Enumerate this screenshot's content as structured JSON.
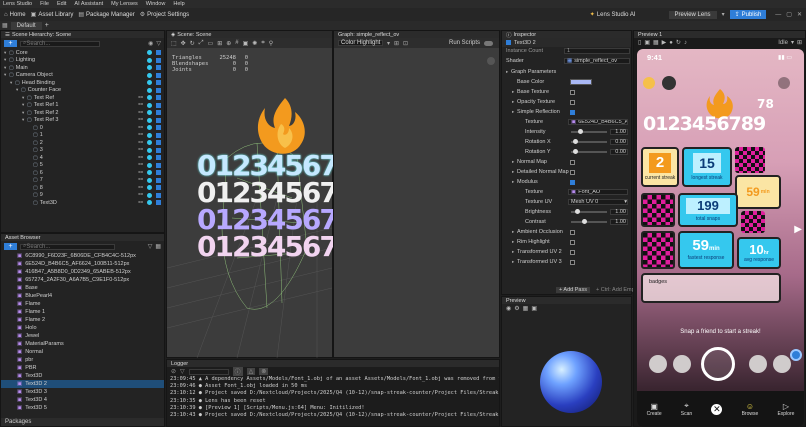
{
  "menu": {
    "items": [
      "Lens Studio",
      "File",
      "Edit",
      "AI Assistant",
      "My Lenses",
      "Window",
      "Help"
    ]
  },
  "toolbar": {
    "home": "Home",
    "asset_library": "Asset Library",
    "package_manager": "Package Manager",
    "project_settings": "Project Settings",
    "lens_studio_ai": "Lens Studio AI",
    "preview_lens": "Preview Lens",
    "publish": "Publish"
  },
  "tabs": {
    "default": "Default"
  },
  "hierarchy": {
    "title": "Scene Hierarchy: Scene",
    "search_placeholder": "Search...",
    "items": [
      {
        "label": "Core",
        "indent": 0
      },
      {
        "label": "Lighting",
        "indent": 0
      },
      {
        "label": "Main",
        "indent": 0
      },
      {
        "label": "Camera Object",
        "indent": 0
      },
      {
        "label": "Head Binding",
        "indent": 1
      },
      {
        "label": "Counter Face",
        "indent": 2
      },
      {
        "label": "Text Ref",
        "indent": 3
      },
      {
        "label": "Text Ref 1",
        "indent": 3
      },
      {
        "label": "Text Ref 2",
        "indent": 3
      },
      {
        "label": "Text Ref 3",
        "indent": 3
      },
      {
        "label": "0",
        "indent": 4
      },
      {
        "label": "1",
        "indent": 4
      },
      {
        "label": "2",
        "indent": 4
      },
      {
        "label": "3",
        "indent": 4
      },
      {
        "label": "4",
        "indent": 4
      },
      {
        "label": "5",
        "indent": 4
      },
      {
        "label": "6",
        "indent": 4
      },
      {
        "label": "7",
        "indent": 4
      },
      {
        "label": "8",
        "indent": 4
      },
      {
        "label": "9",
        "indent": 4
      },
      {
        "label": "Text3D",
        "indent": 4
      }
    ]
  },
  "assets": {
    "title": "Asset Browser",
    "search_placeholder": "Search...",
    "items": [
      "6C8990_F6D23F_6B06DE_CFB4C4C-512px",
      "6E524D_B4B6C5_AF6624_100B11-512px",
      "416B47_A5B8D0_0D2349_65ABEB-512px",
      "657274_2A2F30_A6A7B5_C9E1F0-512px",
      "Base",
      "BluePearl4",
      "Flame",
      "Flame 1",
      "Flame 2",
      "Holo",
      "Jewel",
      "MaterialParams",
      "Normal",
      "pbr",
      "PBR",
      "Text3D",
      "Text3D 2",
      "Text3D 3",
      "Text3D 4",
      "Text3D 5"
    ],
    "selected_index": 16,
    "footer": "Packages"
  },
  "scene": {
    "title": "Scene: Scene",
    "stats": [
      {
        "label": "Triangles",
        "value": "25248",
        "extra": "0"
      },
      {
        "label": "Blendshapes",
        "value": "0",
        "extra": "0"
      },
      {
        "label": "Joints",
        "value": "0",
        "extra": "0"
      }
    ],
    "digits": "0123456789"
  },
  "graph": {
    "title": "Graph: simple_reflect_ov",
    "color_highlight": "Color Highlight",
    "run_scripts": "Run Scripts"
  },
  "logger": {
    "title": "Logger",
    "lines": [
      "23:09:45 ▲ A dependency Assets/Models/Font_1.obj of an asset Assets/Models/Font_1.obj was removed from the",
      "23:09:46 ● Asset Font_1.obj loaded in 50 ms",
      "23:10:12 ● Project saved D:/Nextcloud/Projects/2025/Q4 (10-12)/snap-streak-counter/Project Files/Streak Cou",
      "23:10:35 ● Lens has been reset",
      "23:10:39 ● [Preview 1] [Scripts/Menu.js:64] Menu: Initilized!",
      "23:10:43 ● Project saved D:/Nextcloud/Projects/2025/Q4 (10-12)/snap-streak-counter/Project Files/Streak Cou"
    ]
  },
  "inspector": {
    "title": "Inspector",
    "object": "Text3D 2",
    "top_row": "Instance Count",
    "instance_count": "1",
    "shader_label": "Shader",
    "shader_value": "simple_reflect_ov",
    "sections": {
      "graph_params": "Graph Parameters",
      "base_color": "Base Color",
      "base_texture": "Base Texture",
      "opacity_texture": "Opacity Texture",
      "simple_reflection": "Simple Reflection",
      "texture": "Texture",
      "texture_value": "6E524D_B4B6C5_AF662",
      "intensity": "Intensity",
      "intensity_value": "1.00",
      "rotation_x": "Rotation X",
      "rotation_x_value": "0.00",
      "rotation_y": "Rotation Y",
      "rotation_y_value": "0.00",
      "normal_map": "Normal Map",
      "detailed_normal_map": "Detailed Normal Map",
      "modulus": "Modulus",
      "texture2": "Texture",
      "texture2_value": "Font_AO",
      "texture_uv": "Texture UV",
      "texture_uv_value": "Mesh UV 0",
      "brightness": "Brightness",
      "brightness_value": "1.00",
      "contrast": "Contrast",
      "contrast_value": "1.00",
      "ambient_occlusion": "Ambient Occlusion",
      "rim_highlight": "Rim Highlight",
      "transformed_uv2": "Transformed UV 2",
      "transformed_uv3": "Transformed UV 3"
    },
    "add_pass": "+ Add Pass",
    "add_empty": "+ Ctrl: Add Empty",
    "preview_title": "Preview"
  },
  "preview": {
    "title": "Preview 1",
    "idle": "Idle",
    "time": "9:41",
    "cards": {
      "current_streak_value": "2",
      "current_streak_label": "current streak",
      "longest_streak_value": "15",
      "longest_streak_label": "longest streak",
      "minutes_value": "59",
      "minutes_unit": "min",
      "total_snaps_value": "199",
      "total_snaps_label": "total snaps",
      "fastest_value": "59",
      "fastest_unit": "min",
      "fastest_label": "fastest response",
      "avg_value": "10",
      "avg_unit": "hr",
      "avg_label": "avg response",
      "badges_label": "badges"
    },
    "snap_prompt": "Snap a friend to start a streak!",
    "nav": [
      "Create",
      "Scan",
      "",
      "Browse",
      "Explore"
    ]
  },
  "colors": {
    "accent": "#2f7ed8",
    "orange": "#f39a1e",
    "cyan": "#35c8ee",
    "magenta": "#e01e9c"
  }
}
